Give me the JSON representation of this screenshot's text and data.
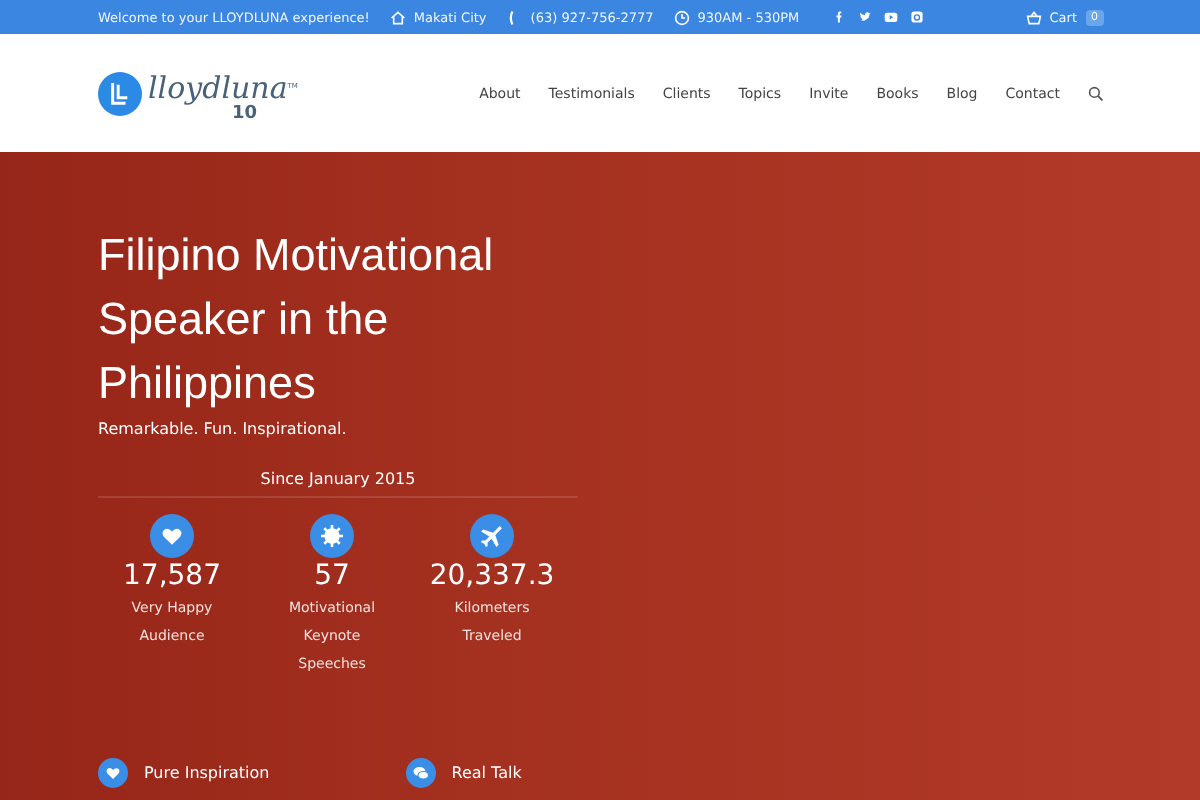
{
  "topbar": {
    "welcome": "Welcome to your LLOYDLUNA experience!",
    "location": "Makati City",
    "phone": "(63) 927-756-2777",
    "hours": "930AM - 530PM",
    "social": [
      {
        "kind": "facebook"
      },
      {
        "kind": "twitter"
      },
      {
        "kind": "youtube"
      },
      {
        "kind": "instagram"
      }
    ],
    "cart": {
      "label": "Cart",
      "count": "0"
    }
  },
  "logo": {
    "name": "lloydluna",
    "tm": "TM",
    "years": "10"
  },
  "nav": [
    {
      "label": "About"
    },
    {
      "label": "Testimonials"
    },
    {
      "label": "Clients"
    },
    {
      "label": "Topics"
    },
    {
      "label": "Invite"
    },
    {
      "label": "Books"
    },
    {
      "label": "Blog"
    },
    {
      "label": "Contact"
    }
  ],
  "hero": {
    "title": "Filipino Motivational Speaker in the Philippines",
    "subtitle": "Remarkable. Fun. Inspirational.",
    "since": "Since January 2015",
    "stats": [
      {
        "kind": "heart",
        "value": "17,587",
        "label_lines": [
          "Very Happy",
          "Audience"
        ]
      },
      {
        "kind": "star",
        "value": "57",
        "label_lines": [
          "Motivational",
          "Keynote",
          "Speeches"
        ]
      },
      {
        "kind": "plane",
        "value": "20,337.3",
        "label_lines": [
          "Kilometers",
          "Traveled"
        ]
      }
    ],
    "features": [
      {
        "kind": "heart",
        "label": "Pure Inspiration"
      },
      {
        "kind": "chat",
        "label": "Real Talk"
      }
    ]
  }
}
